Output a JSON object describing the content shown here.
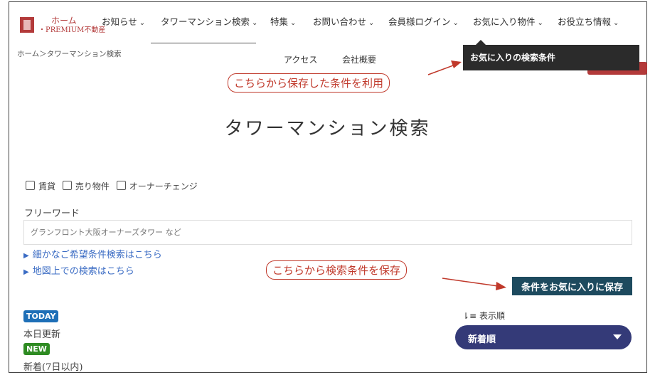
{
  "header": {
    "logo_home": "ホーム",
    "logo_brand": "・PREMIUM不動産",
    "nav": [
      "お知らせ",
      "タワーマンション検索",
      "特集",
      "お問い合わせ",
      "会員様ログイン",
      "お気に入り物件",
      "お役立ち情報"
    ],
    "subnav": [
      "アクセス",
      "会社概要"
    ],
    "dropdown_item": "お気に入りの検索条件"
  },
  "breadcrumb": "ホーム＞タワーマンション検索",
  "callouts": {
    "use_saved": "こちらから保存した条件を利用",
    "save_here": "こちらから検索条件を保存"
  },
  "page_title": "タワーマンション検索",
  "filters": {
    "checkboxes": [
      "賃貸",
      "売り物件",
      "オーナーチェンジ"
    ],
    "freeword_label": "フリーワード",
    "freeword_placeholder": "グランフロント大阪オーナーズタワー など",
    "detail_link": "細かなご希望条件検索はこちら",
    "map_link": "地図上での検索はこちら",
    "save_button": "条件をお気に入りに保存"
  },
  "legend": {
    "today_badge": "TODAY",
    "today_text": "本日更新",
    "new_badge": "NEW",
    "new_text": "新着(7日以内)"
  },
  "sort": {
    "label": "表示順",
    "selected": "新着順"
  },
  "colors": {
    "accent_red": "#b33a3a",
    "callout_red": "#c0392b",
    "save_button": "#1d4a5e",
    "sort_select": "#343a78",
    "today": "#1e6fb7",
    "new": "#2e8b22"
  }
}
